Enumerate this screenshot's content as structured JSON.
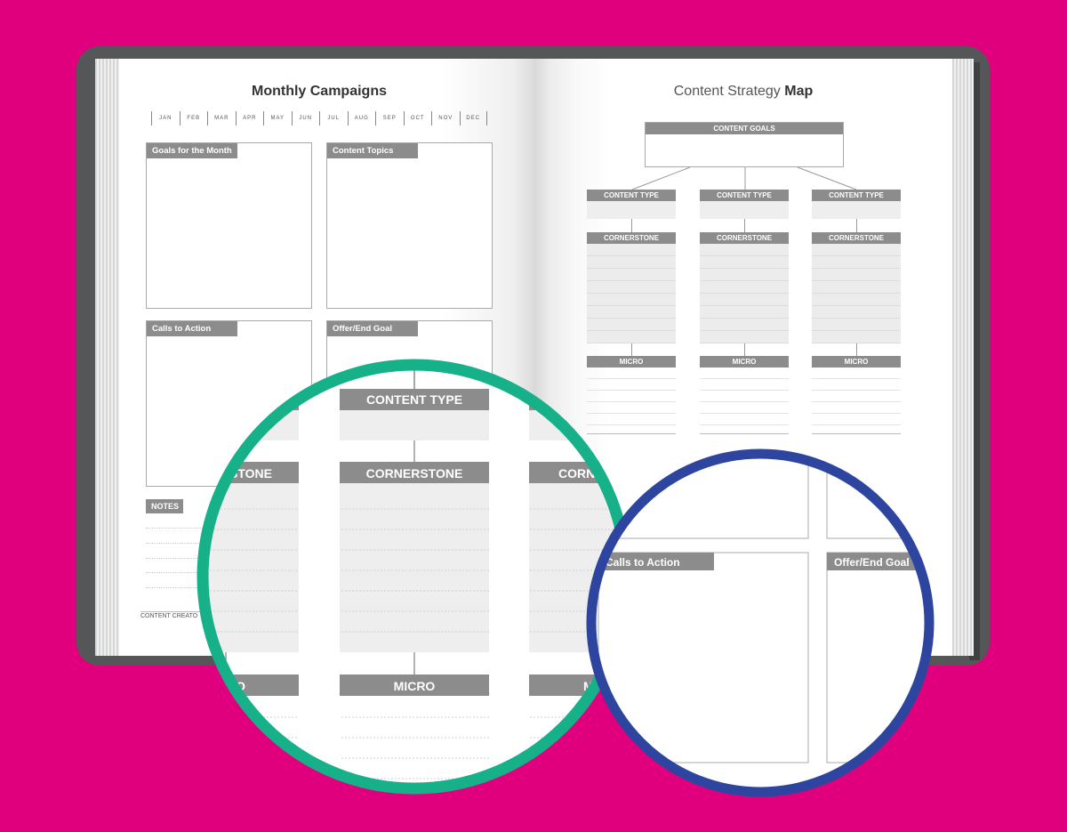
{
  "left_page": {
    "title": "Monthly Campaigns",
    "months": [
      "JAN",
      "FEB",
      "MAR",
      "APR",
      "MAY",
      "JUN",
      "JUL",
      "AUG",
      "SEP",
      "OCT",
      "NOV",
      "DEC"
    ],
    "boxes": {
      "goals": "Goals for the Month",
      "topics": "Content Topics",
      "cta": "Calls to Action",
      "offer": "Offer/End Goal"
    },
    "notes_label": "NOTES",
    "footer": "CONTENT CREATO"
  },
  "right_page": {
    "title_light": "Content Strategy ",
    "title_bold": "Map",
    "content_goals": "CONTENT GOALS",
    "columns": [
      {
        "type": "CONTENT TYPE",
        "cornerstone": "CORNERSTONE",
        "micro": "MICRO"
      },
      {
        "type": "CONTENT TYPE",
        "cornerstone": "CORNERSTONE",
        "micro": "MICRO"
      },
      {
        "type": "CONTENT TYPE",
        "cornerstone": "CORNERSTONE",
        "micro": "MICRO"
      }
    ]
  },
  "zoom_green": {
    "content_type": "CONTENT TYPE",
    "cornerstone": "CORNERSTONE",
    "cornerstone_partial_left": "RSTONE",
    "cornerstone_partial_right": "CORNERS",
    "micro": "MICRO",
    "micro_partial_left": "RO",
    "micro_partial_right": "M",
    "ring_color": "#16b089"
  },
  "zoom_blue": {
    "cta": "Calls to Action",
    "offer": "Offer/End Goal",
    "ring_color": "#2e45a0"
  },
  "colors": {
    "background": "#e0007e",
    "cover": "#555657",
    "label_gray": "#8c8c8c"
  }
}
